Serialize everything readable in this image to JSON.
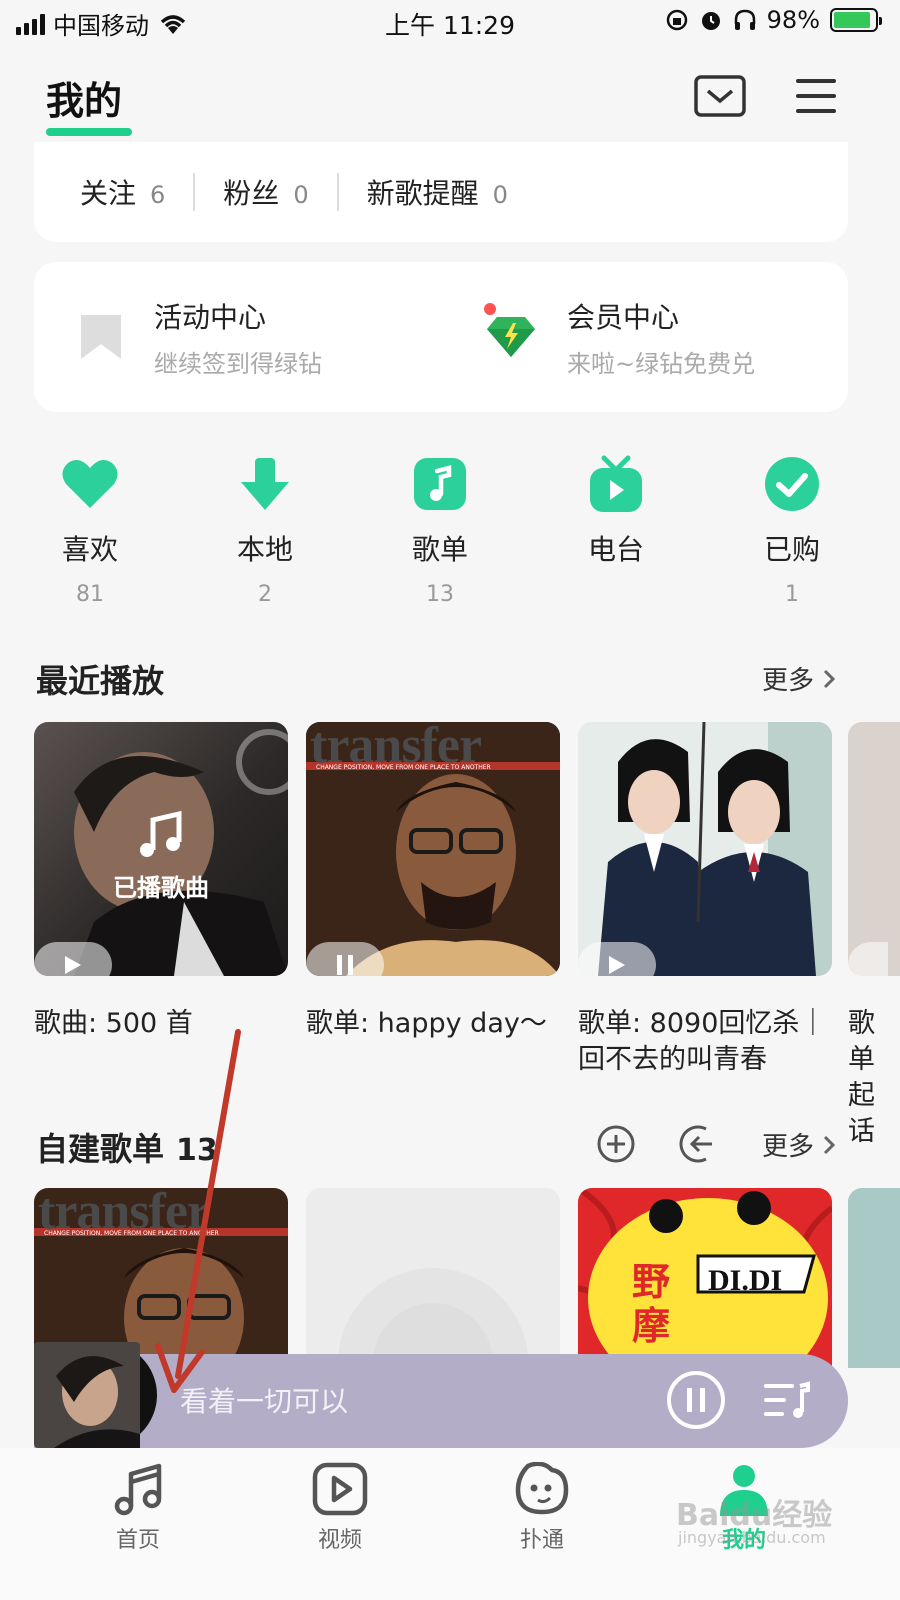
{
  "status_bar": {
    "carrier": "中国移动",
    "time": "上午 11:29",
    "battery": "98%",
    "battery_level": 0.98
  },
  "header": {
    "title": "我的"
  },
  "follow": [
    {
      "label": "关注",
      "value": "6"
    },
    {
      "label": "粉丝",
      "value": "0"
    },
    {
      "label": "新歌提醒",
      "value": "0"
    }
  ],
  "centers": [
    {
      "title": "活动中心",
      "subtitle": "继续签到得绿钻",
      "icon": "bookmark-icon"
    },
    {
      "title": "会员中心",
      "subtitle": "来啦~绿钻免费兑",
      "icon": "diamond-icon"
    }
  ],
  "quick": [
    {
      "label": "喜欢",
      "count": "81",
      "icon": "heart-icon"
    },
    {
      "label": "本地",
      "count": "2",
      "icon": "download-icon"
    },
    {
      "label": "歌单",
      "count": "13",
      "icon": "playlist-icon"
    },
    {
      "label": "电台",
      "count": "",
      "icon": "radio-icon"
    },
    {
      "label": "已购",
      "count": "1",
      "icon": "check-icon"
    }
  ],
  "recent": {
    "title": "最近播放",
    "more": "更多",
    "items": [
      {
        "overlay": "已播歌曲",
        "caption": "歌曲: 500 首",
        "state": "play"
      },
      {
        "cover_text": "transfer",
        "cover_subtext": "CHANGE POSITION, MOVE FROM ONE PLACE TO ANOTHER",
        "caption": "歌单: happy day～",
        "state": "pause"
      },
      {
        "caption": "歌单: 8090回忆杀｜回不去的叫青春",
        "state": "play"
      },
      {
        "caption": "歌单起话",
        "state": "play"
      }
    ]
  },
  "self_playlists": {
    "title": "自建歌单",
    "count": "13",
    "more": "更多",
    "items": [
      {
        "cover_text": "transfer",
        "cover_subtext": "CHANGE POSITION, MOVE FROM ONE PLACE TO ANOTHER"
      },
      {
        "cover_text": ""
      },
      {
        "cover_text": "野摩",
        "cover_badge": "DI.DI"
      },
      {
        "cover_text": ""
      }
    ]
  },
  "player": {
    "song": "看着一切可以"
  },
  "tabs": [
    {
      "label": "首页",
      "icon": "music-note-icon",
      "active": false
    },
    {
      "label": "视频",
      "icon": "video-play-icon",
      "active": false
    },
    {
      "label": "扑通",
      "icon": "chat-face-icon",
      "active": false
    },
    {
      "label": "我的",
      "icon": "profile-icon",
      "active": true
    }
  ],
  "watermark": {
    "text": "Baidu经验",
    "url": "jingyan.baidu.com"
  },
  "colors": {
    "accent": "#1ecf8e",
    "player_bg": "#b3adc8",
    "arrow": "#c0392b"
  }
}
